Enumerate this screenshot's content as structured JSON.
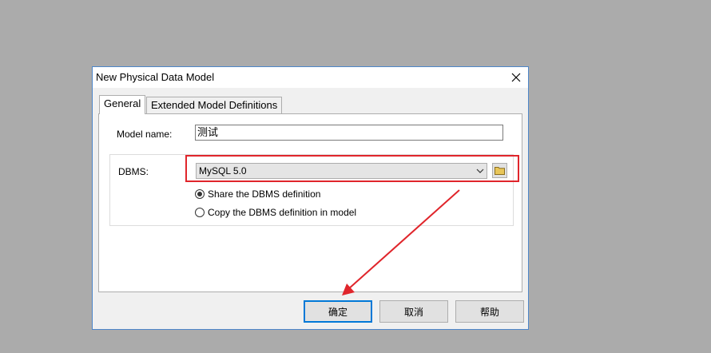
{
  "dialog": {
    "title": "New Physical Data Model",
    "close_symbol": "✕"
  },
  "tabs": [
    {
      "label": "General",
      "active": true
    },
    {
      "label": "Extended Model Definitions",
      "active": false
    }
  ],
  "form": {
    "model_name_label": "Model name:",
    "model_name_value": "测试",
    "dbms_label": "DBMS:",
    "dbms_selected": "MySQL 5.0",
    "options": [
      {
        "label": "Share the DBMS definition",
        "checked": true
      },
      {
        "label": "Copy the DBMS definition in model",
        "checked": false
      }
    ]
  },
  "buttons": {
    "ok": "确定",
    "cancel": "取消",
    "help": "帮助"
  },
  "icons": {
    "close": "close-icon",
    "dropdown": "chevron-down-icon",
    "folder": "folder-icon"
  },
  "colors": {
    "background": "#ababab",
    "annotation": "#e0252b",
    "focus_border": "#0078d7"
  }
}
